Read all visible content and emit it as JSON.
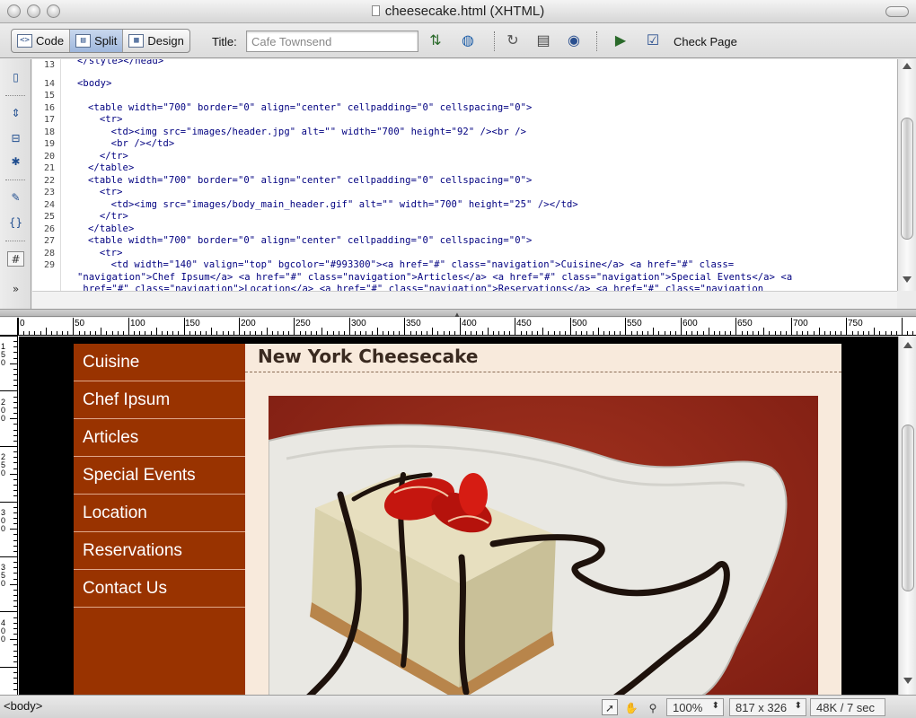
{
  "window": {
    "title": "cheesecake.html (XHTML)"
  },
  "toolbar": {
    "views": [
      {
        "label": "Code",
        "icon": "code-view-icon"
      },
      {
        "label": "Split",
        "icon": "split-view-icon"
      },
      {
        "label": "Design",
        "icon": "design-view-icon"
      }
    ],
    "title_label": "Title:",
    "title_value": "Cafe Townsend",
    "check_page_label": "Check Page"
  },
  "code": {
    "line_numbers": [
      "13",
      "14",
      "15",
      "16",
      "17",
      "18",
      "19",
      "20",
      "21",
      "22",
      "23",
      "24",
      "25",
      "26",
      "27",
      "28",
      "29"
    ],
    "lines": [
      "</style></head>",
      "<body>",
      "",
      "<table width=\"700\" border=\"0\" align=\"center\" cellpadding=\"0\" cellspacing=\"0\">",
      "  <tr>",
      "    <td><img src=\"images/header.jpg\" alt=\"\" width=\"700\" height=\"92\" /><br />",
      "    <br /></td>",
      "  </tr>",
      "</table>",
      "<table width=\"700\" border=\"0\" align=\"center\" cellpadding=\"0\" cellspacing=\"0\">",
      "  <tr>",
      "    <td><img src=\"images/body_main_header.gif\" alt=\"\" width=\"700\" height=\"25\" /></td>",
      "  </tr>",
      "</table>",
      "<table width=\"700\" border=\"0\" align=\"center\" cellpadding=\"0\" cellspacing=\"0\">",
      "  <tr>",
      "    <td width=\"140\" valign=\"top\" bgcolor=\"#993300\"><a href=\"#\" class=\"navigation\">Cuisine</a> <a href=\"#\" class=",
      "\"navigation\">Chef Ipsum</a> <a href=\"#\" class=\"navigation\">Articles</a> <a href=\"#\" class=\"navigation\">Special Events</a> <a",
      " href=\"#\" class=\"navigation\">Location</a> <a href=\"#\" class=\"navigation\">Reservations</a> <a href=\"#\" class=\"navigation"
    ]
  },
  "ruler": {
    "h_labels": [
      "0",
      "50",
      "100",
      "150",
      "200",
      "250",
      "300",
      "350",
      "400",
      "450",
      "500",
      "550",
      "600",
      "650",
      "700",
      "750"
    ],
    "v_labels": [
      "150",
      "200",
      "250",
      "300",
      "350",
      "400"
    ]
  },
  "design": {
    "nav_items": [
      "Cuisine",
      "Chef Ipsum",
      "Articles",
      "Special Events",
      "Location",
      "Reservations",
      "Contact Us"
    ],
    "content_title": "New York Cheesecake",
    "photo_subject": "cheesecake slice with strawberries and chocolate drizzle",
    "colors": {
      "nav_bg": "#993300",
      "content_bg": "#f8eadc",
      "page_bg": "#000000"
    }
  },
  "status": {
    "tag": "<body>",
    "zoom": "100%",
    "window_size": "817 x 326",
    "download": "48K / 7 sec"
  }
}
